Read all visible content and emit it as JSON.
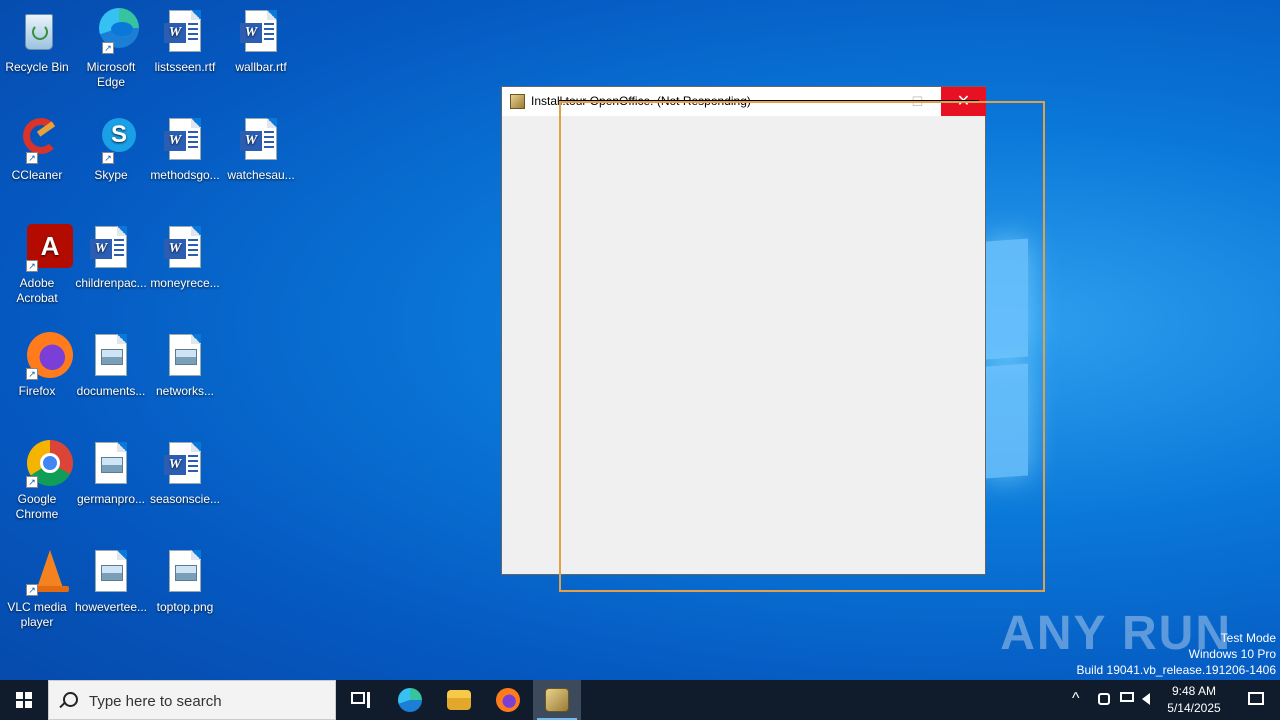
{
  "desktop": {
    "icons": [
      {
        "label": "Recycle Bin"
      },
      {
        "label": "Microsoft Edge"
      },
      {
        "label": "listsseen.rtf"
      },
      {
        "label": "wallbar.rtf"
      },
      {
        "label": "CCleaner"
      },
      {
        "label": "Skype"
      },
      {
        "label": "methodsgo..."
      },
      {
        "label": "watchesau..."
      },
      {
        "label": "Adobe Acrobat"
      },
      {
        "label": "childrenpac..."
      },
      {
        "label": "moneyrece..."
      },
      {
        "label": "Firefox"
      },
      {
        "label": "documents..."
      },
      {
        "label": "networks..."
      },
      {
        "label": "Google Chrome"
      },
      {
        "label": "germanpro..."
      },
      {
        "label": "seasonscie..."
      },
      {
        "label": "VLC media player"
      },
      {
        "label": "howevertee..."
      },
      {
        "label": "toptop.png"
      }
    ]
  },
  "window": {
    "title": "Install.tour OpenOffice. (Not Responding)",
    "minimize_symbol": "—",
    "maximize_symbol": "☐",
    "close_symbol": "✕"
  },
  "watermark": {
    "brand": "ANY RUN",
    "mode": "Test Mode",
    "os": "Windows 10 Pro",
    "build": "Build 19041.vb_release.191206-1406"
  },
  "taskbar": {
    "search_placeholder": "Type here to search",
    "clock_time": "9:48 AM",
    "clock_date": "5/14/2025",
    "tray_overflow": "^"
  },
  "colors": {
    "close_red": "#e81123",
    "taskbar": "#101c2c",
    "drag_outline": "#e3a04a"
  }
}
